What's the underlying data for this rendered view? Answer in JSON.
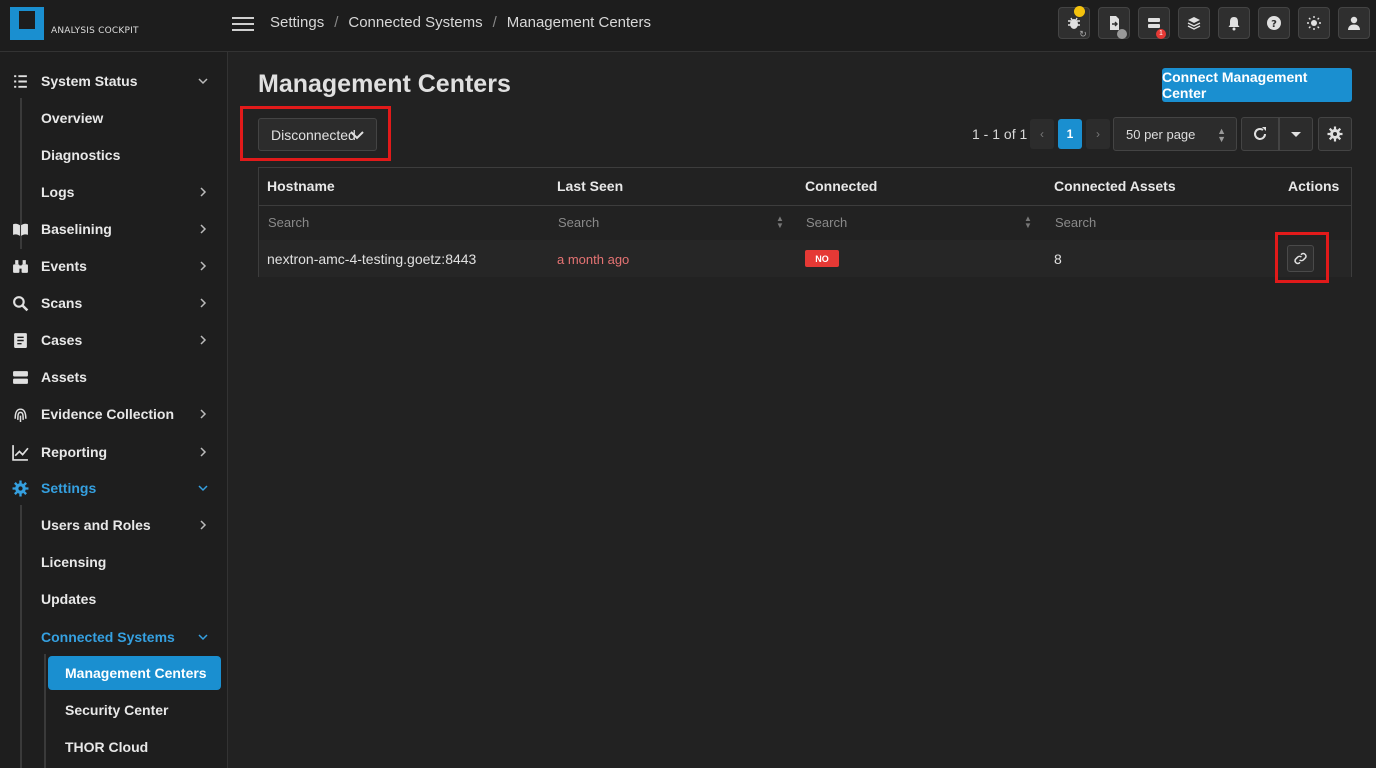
{
  "app": {
    "logo_text": "ANALYSIS COCKPIT"
  },
  "breadcrumb": [
    "Settings",
    "Connected Systems",
    "Management Centers"
  ],
  "topbar_icons": [
    "bug-icon",
    "file-export-icon",
    "server-icon",
    "layers-icon",
    "bell-icon",
    "help-icon",
    "sun-icon",
    "user-icon"
  ],
  "topbar_badges": {
    "server_badge": "1"
  },
  "sidebar": {
    "items": [
      {
        "label": "System Status",
        "icon": "list-icon"
      },
      {
        "label": "Overview"
      },
      {
        "label": "Diagnostics"
      },
      {
        "label": "Logs"
      },
      {
        "label": "Baselining",
        "icon": "book-icon"
      },
      {
        "label": "Events",
        "icon": "binoculars-icon"
      },
      {
        "label": "Scans",
        "icon": "magnify-icon"
      },
      {
        "label": "Cases",
        "icon": "clipboard-icon"
      },
      {
        "label": "Assets",
        "icon": "server-stack-icon"
      },
      {
        "label": "Evidence Collection",
        "icon": "fingerprint-icon"
      },
      {
        "label": "Reporting",
        "icon": "chart-line-icon"
      },
      {
        "label": "Settings",
        "icon": "gear-icon"
      },
      {
        "label": "Users and Roles"
      },
      {
        "label": "Licensing"
      },
      {
        "label": "Updates"
      },
      {
        "label": "Connected Systems"
      },
      {
        "label": "Management Centers"
      },
      {
        "label": "Security Center"
      },
      {
        "label": "THOR Cloud"
      }
    ]
  },
  "main": {
    "title": "Management Centers",
    "primary_button": "Connect Management Center",
    "filter_value": "Disconnected",
    "pagination": {
      "range": "1 - 1 of 1",
      "page": "1",
      "per_page": "50 per page"
    },
    "table": {
      "columns": [
        "Hostname",
        "Last Seen",
        "Connected",
        "Connected Assets",
        "Actions"
      ],
      "search_placeholders": [
        "Search",
        "Search",
        "Search",
        "Search"
      ],
      "rows": [
        {
          "hostname": "nextron-amc-4-testing.goetz:8443",
          "last_seen": "a month ago",
          "connected": "NO",
          "connected_assets": "8"
        }
      ]
    }
  },
  "colors": {
    "accent": "#1a8fd0",
    "danger": "#e53935",
    "highlight_box": "#e11a1a"
  }
}
